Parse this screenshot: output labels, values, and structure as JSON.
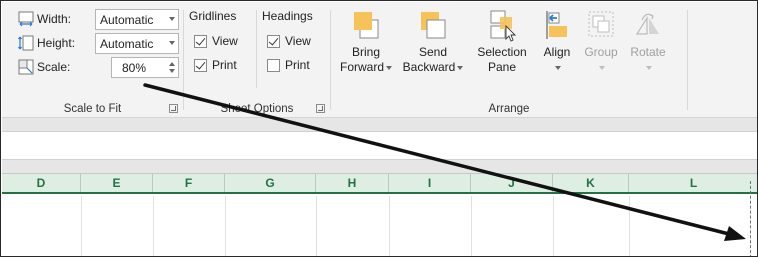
{
  "scale_to_fit": {
    "width_label": "Width:",
    "width_value": "Automatic",
    "height_label": "Height:",
    "height_value": "Automatic",
    "scale_label": "Scale:",
    "scale_value": "80%",
    "group_label": "Scale to Fit"
  },
  "sheet_options": {
    "gridlines_header": "Gridlines",
    "headings_header": "Headings",
    "gridlines_view": {
      "label": "View",
      "checked": true
    },
    "gridlines_print": {
      "label": "Print",
      "checked": true
    },
    "headings_view": {
      "label": "View",
      "checked": true
    },
    "headings_print": {
      "label": "Print",
      "checked": false
    },
    "group_label": "Sheet Options"
  },
  "arrange": {
    "group_label": "Arrange",
    "buttons": [
      {
        "line1": "Bring",
        "line2": "Forward",
        "icon": "bring-forward-icon",
        "dropdown": true,
        "enabled": true
      },
      {
        "line1": "Send",
        "line2": "Backward",
        "icon": "send-backward-icon",
        "dropdown": true,
        "enabled": true
      },
      {
        "line1": "Selection",
        "line2": "Pane",
        "icon": "selection-pane-icon",
        "dropdown": false,
        "enabled": true
      },
      {
        "line1": "Align",
        "line2": "",
        "icon": "align-icon",
        "dropdown": true,
        "enabled": true
      },
      {
        "line1": "Group",
        "line2": "",
        "icon": "group-icon",
        "dropdown": true,
        "enabled": false
      },
      {
        "line1": "Rotate",
        "line2": "",
        "icon": "rotate-icon",
        "dropdown": true,
        "enabled": false
      }
    ]
  },
  "columns": [
    "D",
    "E",
    "F",
    "G",
    "H",
    "I",
    "J",
    "K",
    "L"
  ],
  "colors": {
    "excel_green": "#217346",
    "header_bg": "#dfeee2",
    "object_orange": "#f6c25a",
    "align_blue": "#2b7cd3"
  }
}
